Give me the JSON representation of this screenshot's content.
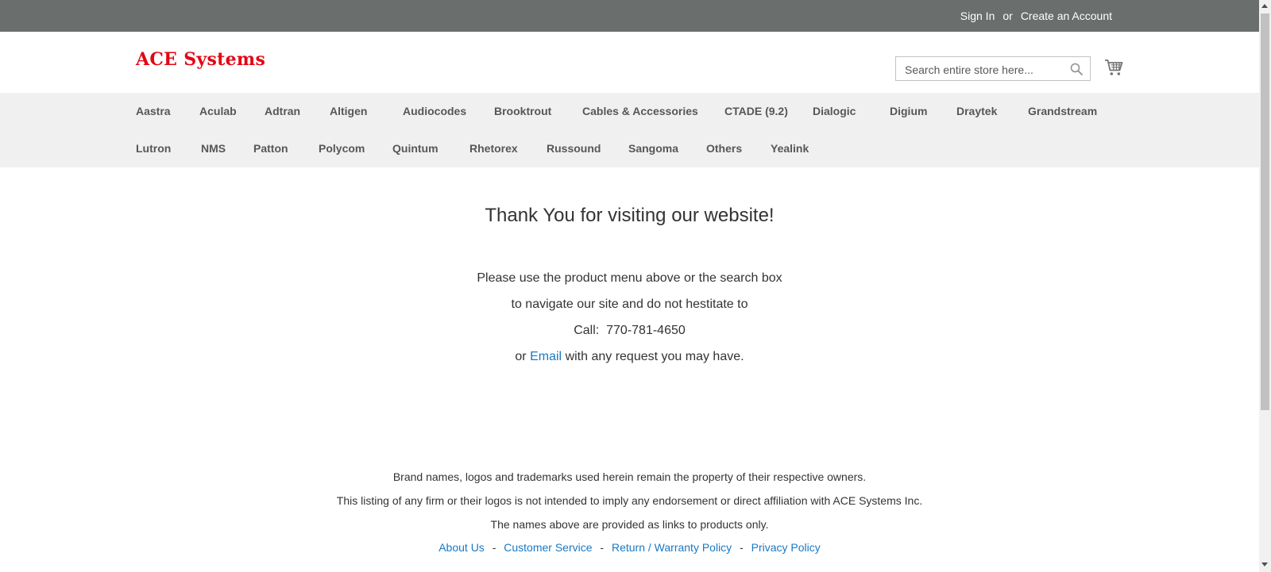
{
  "top_links": {
    "sign_in": "Sign In",
    "or": "or",
    "create_account": "Create an Account"
  },
  "header": {
    "logo": "ACE Systems",
    "search_placeholder": "Search entire store here..."
  },
  "nav": {
    "row1": [
      "Aastra",
      "Aculab",
      "Adtran",
      "Altigen",
      "Audiocodes",
      "Brooktrout",
      "Cables & Accessories",
      "CTADE (9.2)",
      "Dialogic",
      "Digium",
      "Draytek",
      "Grandstream"
    ],
    "row2": [
      "Lutron",
      "NMS",
      "Patton",
      "Polycom",
      "Quintum",
      "Rhetorex",
      "Russound",
      "Sangoma",
      "Others",
      "Yealink"
    ]
  },
  "main": {
    "headline": "Thank You for visiting our website!",
    "line1": "Please use the product menu above or the search box",
    "line2": "to navigate our site and do not hestitate to",
    "line3": "Call:  770-781-4650",
    "line4_prefix": "or",
    "line4_link": "Email",
    "line4_suffix": "with any request you may have."
  },
  "footer": {
    "line1": "Brand names, logos and trademarks used herein remain the property of their respective owners.",
    "line2": "This listing of any firm or their logos is not intended to imply any endorsement or direct affiliation with ACE Systems Inc.",
    "line3": "The names above are provided as links to products only.",
    "separator": "-",
    "links": [
      "About Us",
      "Customer Service",
      "Return / Warranty Policy",
      "Privacy Policy"
    ]
  },
  "colors": {
    "topbar": "#6a6e6c",
    "nav_bg": "#f0f0f0",
    "logo": "#e30613",
    "link": "#1979c3"
  },
  "icons": {
    "search": "search-icon",
    "cart": "cart-icon"
  }
}
